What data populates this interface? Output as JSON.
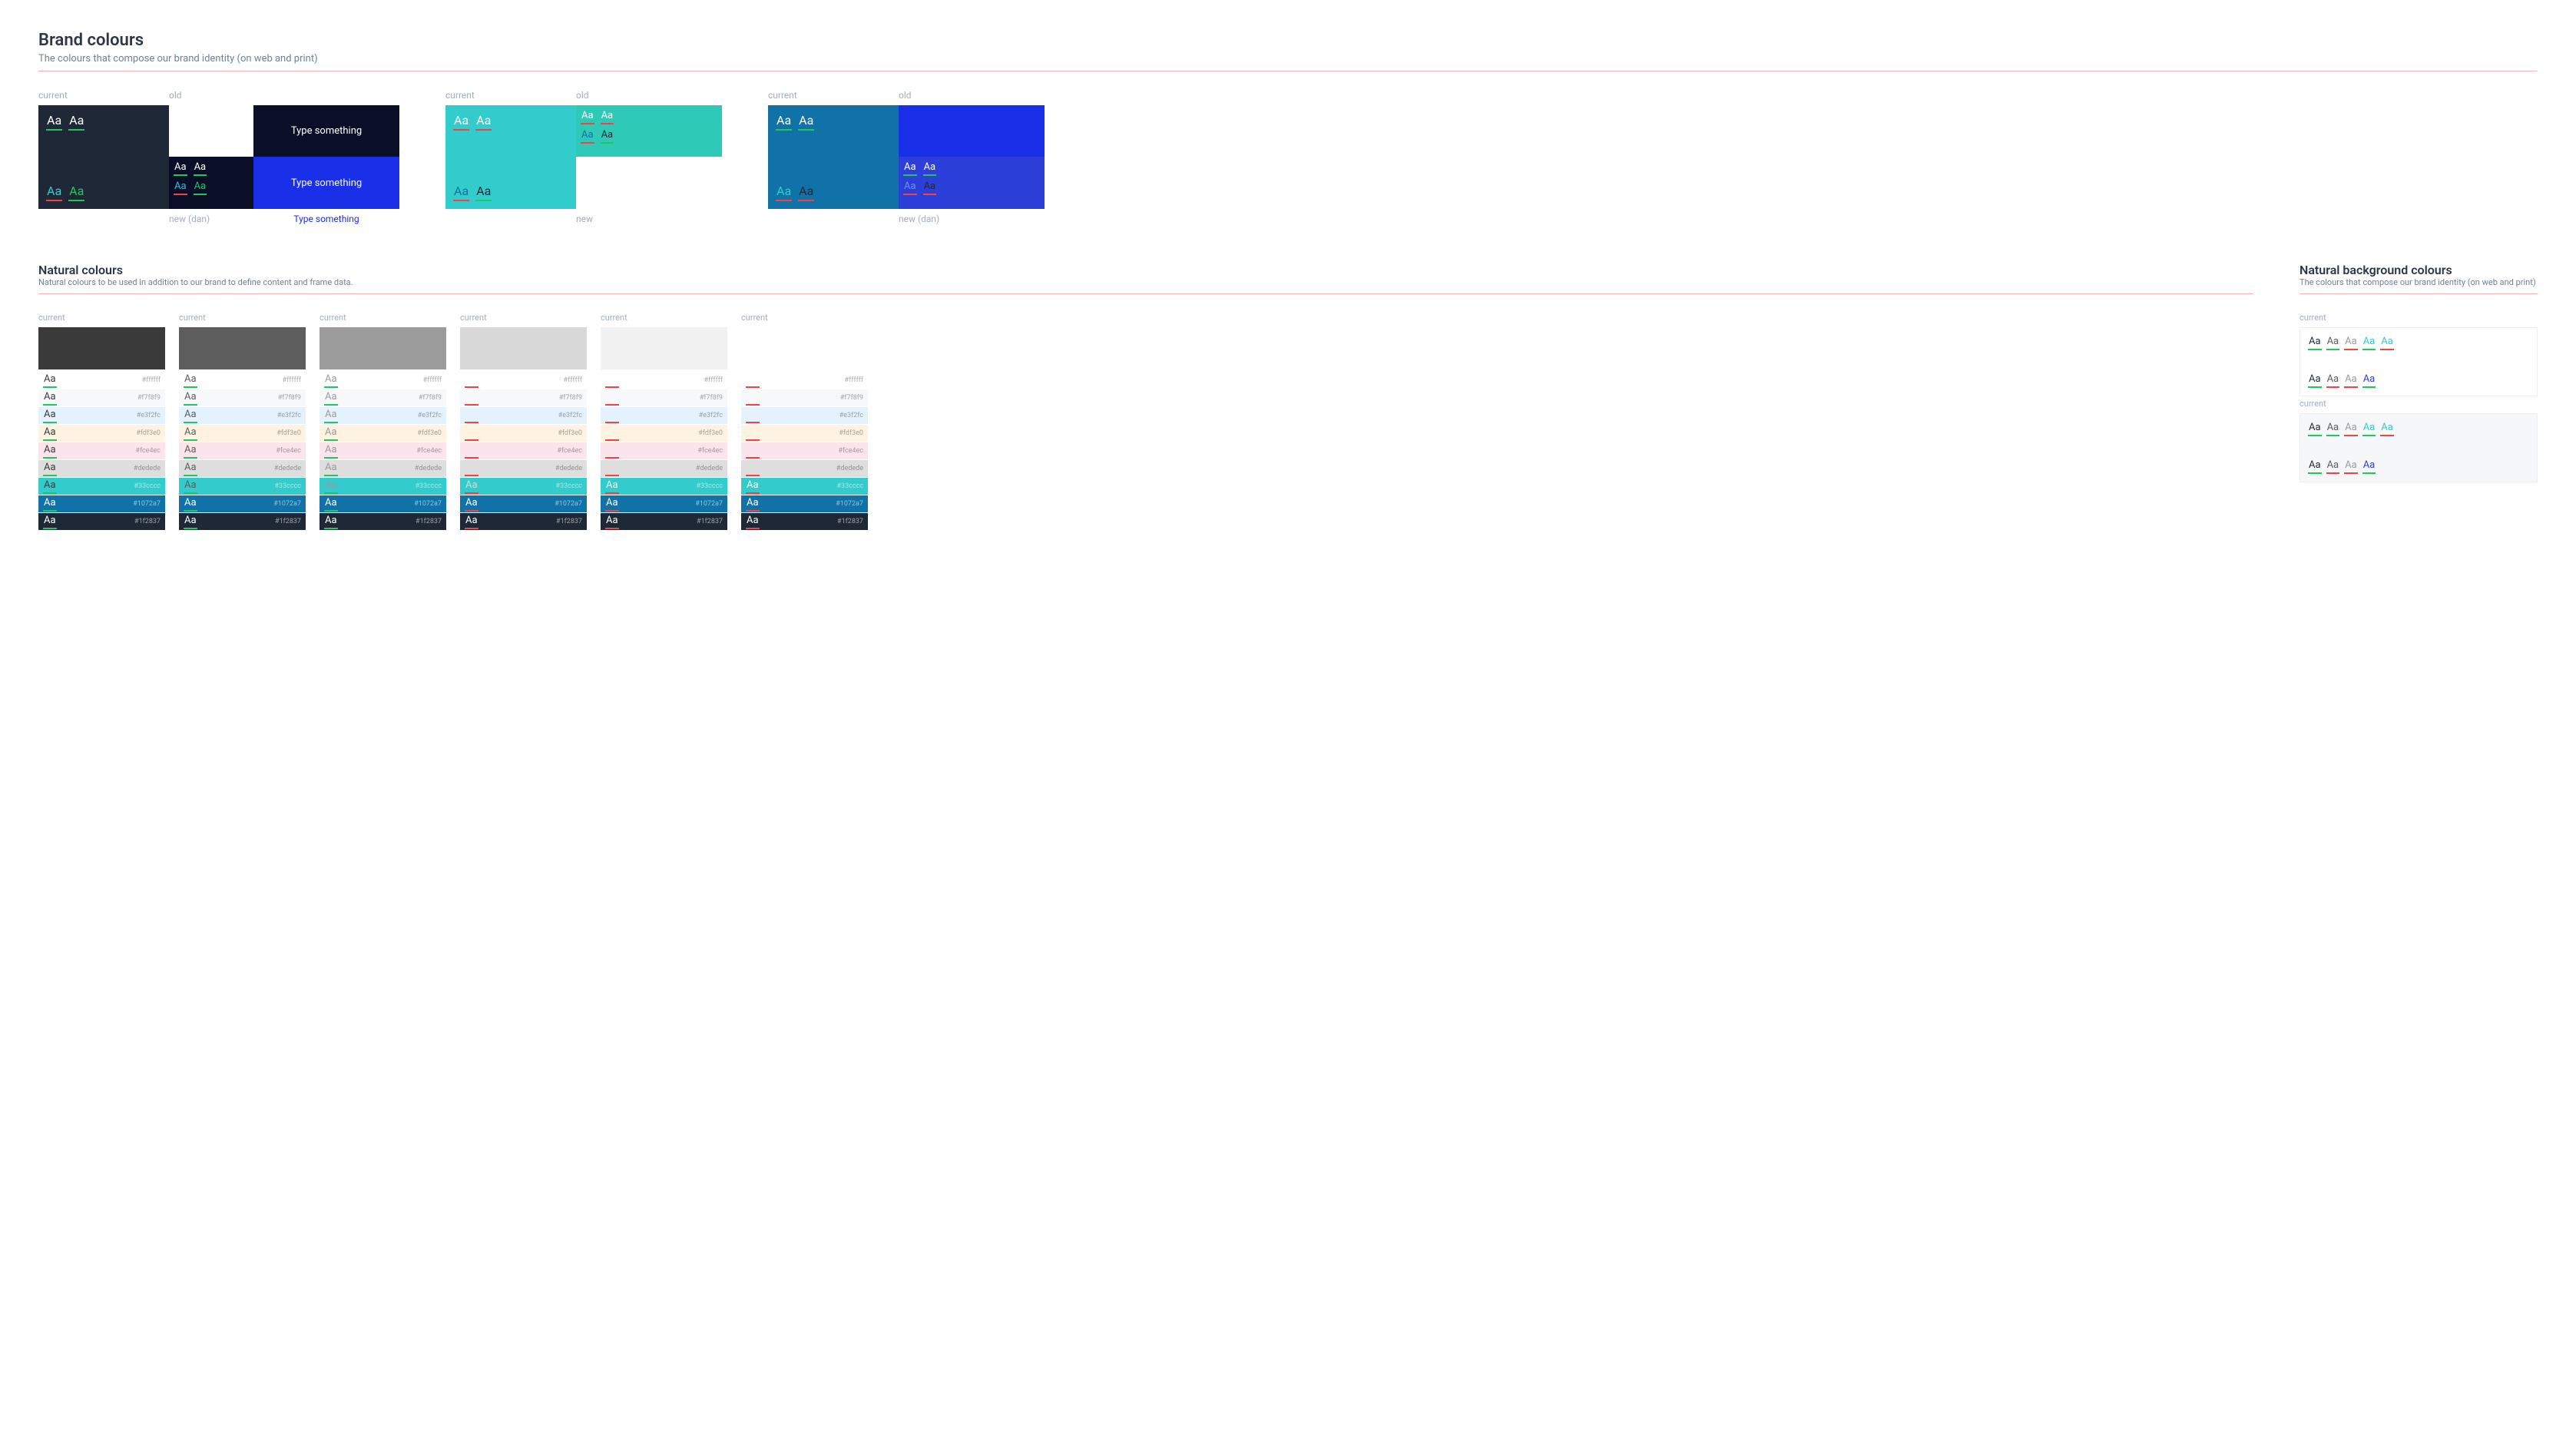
{
  "aa": "Aa",
  "brand_section": {
    "title": "Brand colours",
    "subtitle": "The colours that compose our brand identity (on web and print)"
  },
  "labels": {
    "current": "current",
    "old": "old",
    "new": "new",
    "new_dan": "new (dan)",
    "type_something": "Type something"
  },
  "brand_groups": [
    {
      "current": {
        "bg": "#1f2837",
        "top": [
          {
            "c": "#ffffff",
            "u": "green"
          },
          {
            "c": "#ffffff",
            "u": "green"
          }
        ],
        "bot": [
          {
            "c": "#33cccc",
            "u": "red"
          },
          {
            "c": "#22c55e",
            "u": "green"
          }
        ]
      },
      "old": {
        "bg": "#0a0e27",
        "text_color": "#ffffff"
      },
      "subcol_left": {
        "bg": "#0a0e27",
        "top": [
          {
            "c": "#ffffff",
            "u": "green"
          },
          {
            "c": "#ffffff",
            "u": "green"
          }
        ],
        "bot": [
          {
            "c": "#33bbdd",
            "u": "red"
          },
          {
            "c": "#22c55e",
            "u": "green"
          }
        ]
      },
      "subcol_right": {
        "bg": "#1a2fe8",
        "text_color": "#ffffff"
      },
      "bottom_left_label": "new_dan",
      "bottom_right_text_color": "#1a2fe8"
    },
    {
      "current": {
        "bg": "#33cccc",
        "top": [
          {
            "c": "#ffffff",
            "u": "red"
          },
          {
            "c": "#ffffff",
            "u": "red"
          }
        ],
        "bot": [
          {
            "c": "#1072a7",
            "u": "red"
          },
          {
            "c": "#1f2837",
            "u": "green"
          }
        ]
      },
      "old": {
        "bg": "#2fc9b8",
        "top": [
          {
            "c": "#ffffff",
            "u": "red"
          },
          {
            "c": "#ffffff",
            "u": "red"
          }
        ],
        "bot": [
          {
            "c": "#1072a7",
            "u": "red"
          },
          {
            "c": "#1f2837",
            "u": "green"
          }
        ]
      },
      "bottom_label": "new"
    },
    {
      "current": {
        "bg": "#1072a7",
        "top": [
          {
            "c": "#ffffff",
            "u": "green"
          },
          {
            "c": "#ffffff",
            "u": "green"
          }
        ],
        "bot": [
          {
            "c": "#33cccc",
            "u": "red"
          },
          {
            "c": "#1f2837",
            "u": "red"
          }
        ]
      },
      "old": {
        "bg": "#1a2fe8"
      },
      "sub": {
        "bg": "#2c3fd8",
        "top": [
          {
            "c": "#ffffff",
            "u": "green"
          },
          {
            "c": "#ffffff",
            "u": "green"
          }
        ],
        "bot": [
          {
            "c": "#6a8fff",
            "u": "red"
          },
          {
            "c": "#1f2837",
            "u": "red"
          }
        ]
      },
      "bottom_label": "new_dan"
    }
  ],
  "natural_section": {
    "title": "Natural colours",
    "subtitle": "Natural colours to be used in addition to our brand to define content and frame data."
  },
  "natural_top_colors": [
    "#3a3a3a",
    "#5d5d5d",
    "#9b9b9b",
    "#d8d8d8",
    "#f1f1f1",
    "#ffffff"
  ],
  "natural_rows": [
    {
      "bg": "#ffffff",
      "hex": "#ffffff",
      "u_for_dark_text": "green",
      "u_for_light_text": "red"
    },
    {
      "bg": "#f7f8f9",
      "hex": "#f7f8f9",
      "u_for_dark_text": "green",
      "u_for_light_text": "red"
    },
    {
      "bg": "#e3f2fc",
      "hex": "#e3f2fc",
      "u_for_dark_text": "green",
      "u_for_light_text": "red"
    },
    {
      "bg": "#fdf3e0",
      "hex": "#fdf3e0",
      "u_for_dark_text": "green",
      "u_for_light_text": "red"
    },
    {
      "bg": "#fce4ec",
      "hex": "#fce4ec",
      "u_for_dark_text": "green",
      "u_for_light_text": "red"
    },
    {
      "bg": "#dedede",
      "hex": "#dedede",
      "u_for_dark_text": "green",
      "u_for_light_text": "red"
    },
    {
      "bg": "#33cccc",
      "hex": "#33cccc",
      "u_for_dark_text": "green",
      "u_for_light_text": "red",
      "hex_light": true
    },
    {
      "bg": "#1072a7",
      "hex": "#1072a7",
      "u_for_dark_text": "red",
      "u_for_light_text": "green",
      "hex_light": true,
      "aa_white": true
    },
    {
      "bg": "#1f2837",
      "hex": "#1f2837",
      "u_for_dark_text": "red",
      "u_for_light_text": "green",
      "hex_light": true,
      "aa_white": true
    }
  ],
  "natural_aa_visibility": [
    [
      1,
      1,
      1,
      1,
      1,
      1,
      1,
      1,
      1
    ],
    [
      1,
      1,
      1,
      1,
      1,
      1,
      1,
      1,
      1
    ],
    [
      1,
      1,
      1,
      1,
      1,
      1,
      1,
      1,
      1
    ],
    [
      0,
      0,
      0,
      0,
      0,
      0,
      1,
      1,
      1
    ],
    [
      0,
      0,
      0,
      0,
      0,
      0,
      1,
      1,
      1
    ],
    [
      0,
      0,
      0,
      0,
      0,
      0,
      1,
      1,
      1
    ]
  ],
  "natbg_section": {
    "title": "Natural background colours",
    "subtitle": "The colours that compose our brand identity (on web and print)"
  },
  "natbg_blocks": [
    {
      "bg": "#ffffff",
      "top": [
        {
          "c": "#1f2837",
          "u": "green"
        },
        {
          "c": "#5d5d5d",
          "u": "green"
        },
        {
          "c": "#9b9b9b",
          "u": "red"
        },
        {
          "c": "#33cccc",
          "u": "green"
        },
        {
          "c": "#33cccc",
          "u": "red"
        }
      ],
      "bot": [
        {
          "c": "#1f2837",
          "u": "green"
        },
        {
          "c": "#5d5d5d",
          "u": "red"
        },
        {
          "c": "#9b9b9b",
          "u": "red"
        },
        {
          "c": "#2c3fd8",
          "u": "green"
        }
      ]
    },
    {
      "bg": "#f6f7f8",
      "top": [
        {
          "c": "#1f2837",
          "u": "green"
        },
        {
          "c": "#5d5d5d",
          "u": "green"
        },
        {
          "c": "#9b9b9b",
          "u": "red"
        },
        {
          "c": "#33cccc",
          "u": "green"
        },
        {
          "c": "#33cccc",
          "u": "red"
        }
      ],
      "bot": [
        {
          "c": "#1f2837",
          "u": "green"
        },
        {
          "c": "#5d5d5d",
          "u": "red"
        },
        {
          "c": "#9b9b9b",
          "u": "red"
        },
        {
          "c": "#2c3fd8",
          "u": "green"
        }
      ]
    }
  ]
}
